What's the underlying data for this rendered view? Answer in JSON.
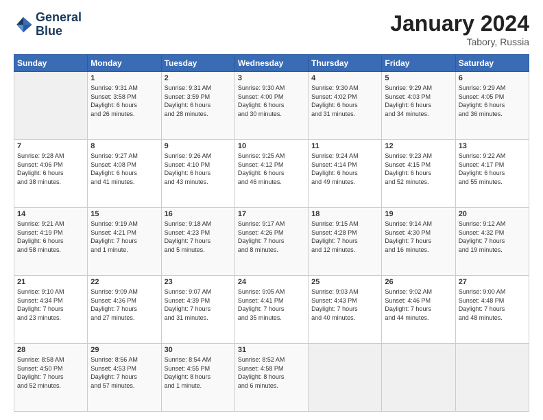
{
  "header": {
    "logo_line1": "General",
    "logo_line2": "Blue",
    "month_year": "January 2024",
    "location": "Tabory, Russia"
  },
  "weekdays": [
    "Sunday",
    "Monday",
    "Tuesday",
    "Wednesday",
    "Thursday",
    "Friday",
    "Saturday"
  ],
  "weeks": [
    [
      {
        "day": "",
        "info": ""
      },
      {
        "day": "1",
        "info": "Sunrise: 9:31 AM\nSunset: 3:58 PM\nDaylight: 6 hours\nand 26 minutes."
      },
      {
        "day": "2",
        "info": "Sunrise: 9:31 AM\nSunset: 3:59 PM\nDaylight: 6 hours\nand 28 minutes."
      },
      {
        "day": "3",
        "info": "Sunrise: 9:30 AM\nSunset: 4:00 PM\nDaylight: 6 hours\nand 30 minutes."
      },
      {
        "day": "4",
        "info": "Sunrise: 9:30 AM\nSunset: 4:02 PM\nDaylight: 6 hours\nand 31 minutes."
      },
      {
        "day": "5",
        "info": "Sunrise: 9:29 AM\nSunset: 4:03 PM\nDaylight: 6 hours\nand 34 minutes."
      },
      {
        "day": "6",
        "info": "Sunrise: 9:29 AM\nSunset: 4:05 PM\nDaylight: 6 hours\nand 36 minutes."
      }
    ],
    [
      {
        "day": "7",
        "info": "Sunrise: 9:28 AM\nSunset: 4:06 PM\nDaylight: 6 hours\nand 38 minutes."
      },
      {
        "day": "8",
        "info": "Sunrise: 9:27 AM\nSunset: 4:08 PM\nDaylight: 6 hours\nand 41 minutes."
      },
      {
        "day": "9",
        "info": "Sunrise: 9:26 AM\nSunset: 4:10 PM\nDaylight: 6 hours\nand 43 minutes."
      },
      {
        "day": "10",
        "info": "Sunrise: 9:25 AM\nSunset: 4:12 PM\nDaylight: 6 hours\nand 46 minutes."
      },
      {
        "day": "11",
        "info": "Sunrise: 9:24 AM\nSunset: 4:14 PM\nDaylight: 6 hours\nand 49 minutes."
      },
      {
        "day": "12",
        "info": "Sunrise: 9:23 AM\nSunset: 4:15 PM\nDaylight: 6 hours\nand 52 minutes."
      },
      {
        "day": "13",
        "info": "Sunrise: 9:22 AM\nSunset: 4:17 PM\nDaylight: 6 hours\nand 55 minutes."
      }
    ],
    [
      {
        "day": "14",
        "info": "Sunrise: 9:21 AM\nSunset: 4:19 PM\nDaylight: 6 hours\nand 58 minutes."
      },
      {
        "day": "15",
        "info": "Sunrise: 9:19 AM\nSunset: 4:21 PM\nDaylight: 7 hours\nand 1 minute."
      },
      {
        "day": "16",
        "info": "Sunrise: 9:18 AM\nSunset: 4:23 PM\nDaylight: 7 hours\nand 5 minutes."
      },
      {
        "day": "17",
        "info": "Sunrise: 9:17 AM\nSunset: 4:26 PM\nDaylight: 7 hours\nand 8 minutes."
      },
      {
        "day": "18",
        "info": "Sunrise: 9:15 AM\nSunset: 4:28 PM\nDaylight: 7 hours\nand 12 minutes."
      },
      {
        "day": "19",
        "info": "Sunrise: 9:14 AM\nSunset: 4:30 PM\nDaylight: 7 hours\nand 16 minutes."
      },
      {
        "day": "20",
        "info": "Sunrise: 9:12 AM\nSunset: 4:32 PM\nDaylight: 7 hours\nand 19 minutes."
      }
    ],
    [
      {
        "day": "21",
        "info": "Sunrise: 9:10 AM\nSunset: 4:34 PM\nDaylight: 7 hours\nand 23 minutes."
      },
      {
        "day": "22",
        "info": "Sunrise: 9:09 AM\nSunset: 4:36 PM\nDaylight: 7 hours\nand 27 minutes."
      },
      {
        "day": "23",
        "info": "Sunrise: 9:07 AM\nSunset: 4:39 PM\nDaylight: 7 hours\nand 31 minutes."
      },
      {
        "day": "24",
        "info": "Sunrise: 9:05 AM\nSunset: 4:41 PM\nDaylight: 7 hours\nand 35 minutes."
      },
      {
        "day": "25",
        "info": "Sunrise: 9:03 AM\nSunset: 4:43 PM\nDaylight: 7 hours\nand 40 minutes."
      },
      {
        "day": "26",
        "info": "Sunrise: 9:02 AM\nSunset: 4:46 PM\nDaylight: 7 hours\nand 44 minutes."
      },
      {
        "day": "27",
        "info": "Sunrise: 9:00 AM\nSunset: 4:48 PM\nDaylight: 7 hours\nand 48 minutes."
      }
    ],
    [
      {
        "day": "28",
        "info": "Sunrise: 8:58 AM\nSunset: 4:50 PM\nDaylight: 7 hours\nand 52 minutes."
      },
      {
        "day": "29",
        "info": "Sunrise: 8:56 AM\nSunset: 4:53 PM\nDaylight: 7 hours\nand 57 minutes."
      },
      {
        "day": "30",
        "info": "Sunrise: 8:54 AM\nSunset: 4:55 PM\nDaylight: 8 hours\nand 1 minute."
      },
      {
        "day": "31",
        "info": "Sunrise: 8:52 AM\nSunset: 4:58 PM\nDaylight: 8 hours\nand 6 minutes."
      },
      {
        "day": "",
        "info": ""
      },
      {
        "day": "",
        "info": ""
      },
      {
        "day": "",
        "info": ""
      }
    ]
  ]
}
